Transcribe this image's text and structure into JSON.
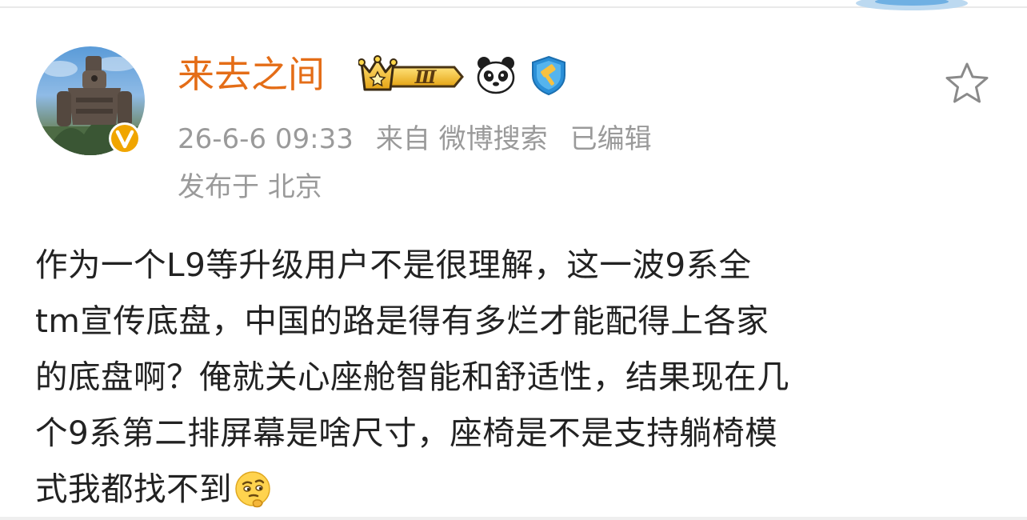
{
  "post": {
    "username": "来去之间",
    "level_badge": "Ⅲ",
    "timestamp": "26-6-6 09:33",
    "source": "来自 微博搜索",
    "edited": "已编辑",
    "location": "发布于 北京",
    "body_lines": [
      "作为一个L9等升级用户不是很理解，这一波9系全",
      "tm宣传底盘，中国的路是得有多烂才能配得上各家",
      "的底盘啊？俺就关心座舱智能和舒适性，结果现在几",
      "个9系第二排屏幕是啥尺寸，座椅是不是支持躺椅模",
      "式我都找不到"
    ]
  },
  "icons": {
    "verified": "verified-v-badge-icon",
    "crown": "vip-crown-icon",
    "panda": "panda-badge-icon",
    "hammer": "hammer-shield-icon",
    "star": "favorite-star-icon",
    "emoji": "thinking-face-emoji-icon"
  },
  "colors": {
    "username": "#e46d17",
    "meta": "#9a9a9a",
    "body_text": "#222222",
    "verified_badge": "#f0a500"
  }
}
